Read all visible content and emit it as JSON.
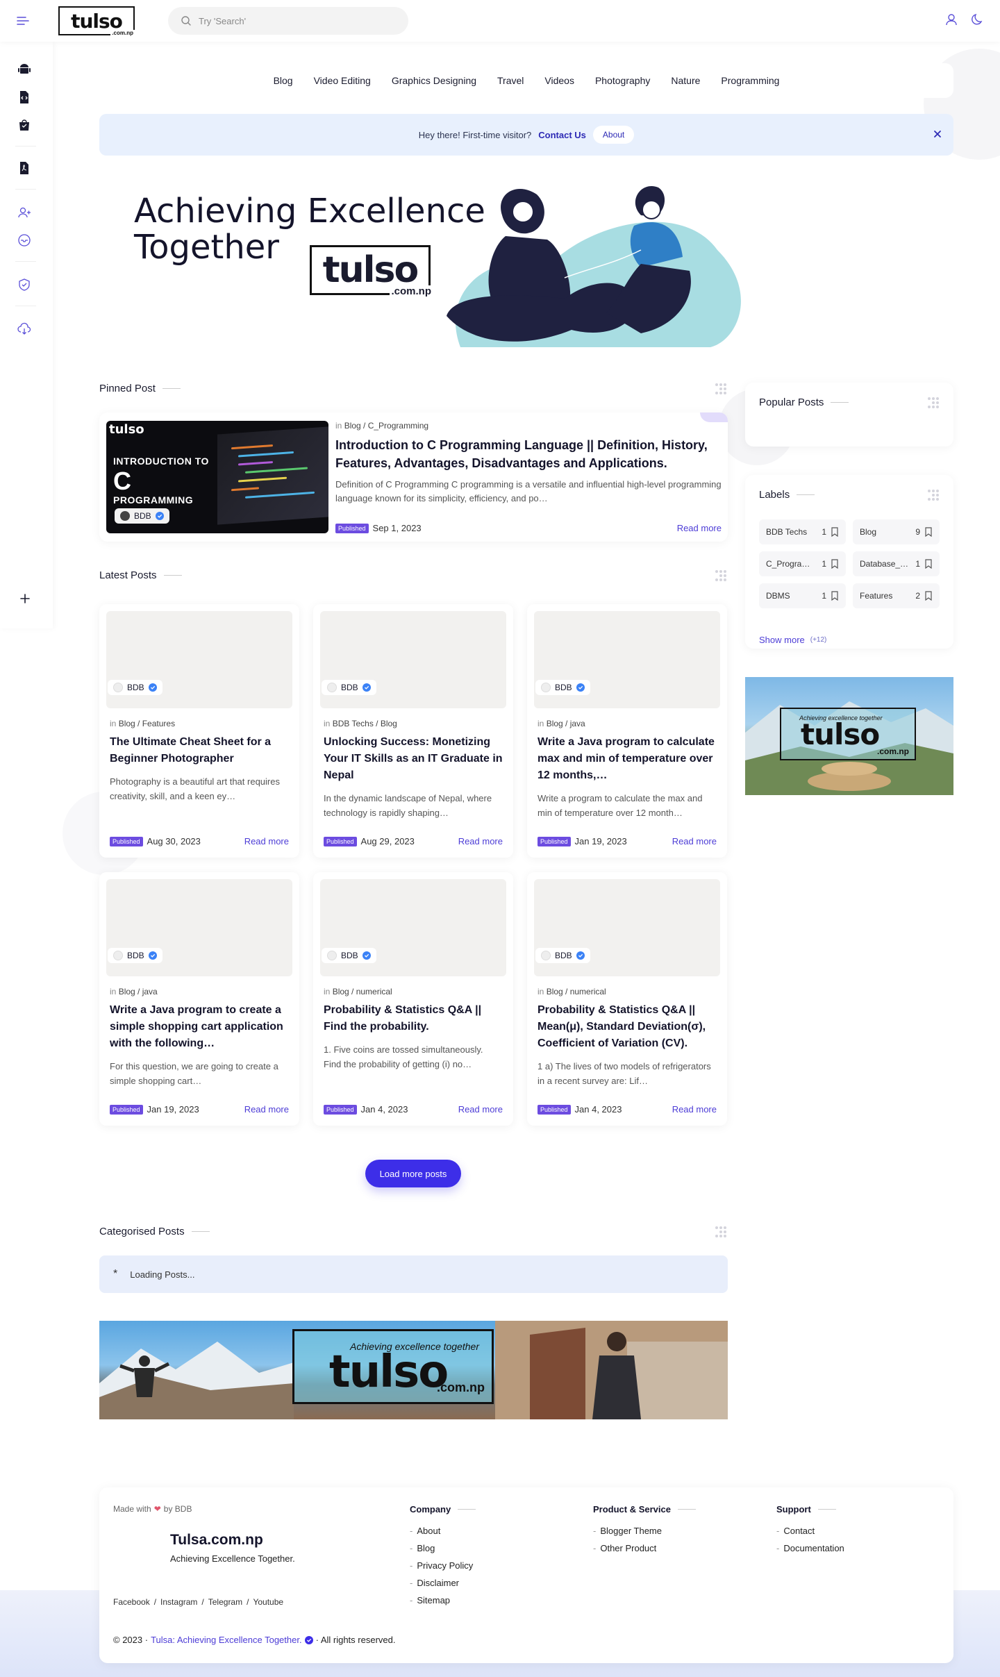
{
  "header": {
    "logo_text": "tulso",
    "logo_sub": ".com.np",
    "search_placeholder": "Try 'Search'"
  },
  "nav": [
    "Blog",
    "Video Editing",
    "Graphics Designing",
    "Travel",
    "Videos",
    "Photography",
    "Nature",
    "Programming"
  ],
  "notice": {
    "text": "Hey there! First-time visitor?",
    "link": "Contact Us",
    "button": "About"
  },
  "hero": {
    "line1": "Achieving Excellence",
    "line2": "Together",
    "logo_text": "tulso",
    "logo_sub": ".com.np"
  },
  "pinned": {
    "section_title": "Pinned Post",
    "thumb": {
      "logo": "tulso",
      "t1": "INTRODUCTION TO",
      "t2": "C",
      "t3": "PROGRAMMING",
      "author": "BDB"
    },
    "crumb_prefix": "in",
    "crumb": "Blog / C_Programming",
    "title": "Introduction to C Programming Language || Definition, History, Features, Advantages, Disadvantages and Applications.",
    "excerpt": "Definition of C Programming C programming is a versatile and influential high-level programming language known for its simplicity, efficiency, and po…",
    "badge": "Published",
    "date": "Sep 1, 2023",
    "read_more": "Read more"
  },
  "latest": {
    "section_title": "Latest Posts",
    "posts": [
      {
        "author": "BDB",
        "crumb": "Blog / Features",
        "title": "The Ultimate Cheat Sheet for a Beginner Photographer",
        "excerpt": "Photography is a beautiful art that requires creativity, skill, and a keen ey…",
        "badge": "Published",
        "date": "Aug 30, 2023",
        "read_more": "Read more"
      },
      {
        "author": "BDB",
        "crumb": "BDB Techs / Blog",
        "title": "Unlocking Success: Monetizing Your IT Skills as an IT Graduate in Nepal",
        "excerpt": "In the dynamic landscape of Nepal, where technology is rapidly shaping…",
        "badge": "Published",
        "date": "Aug 29, 2023",
        "read_more": "Read more"
      },
      {
        "author": "BDB",
        "crumb": "Blog / java",
        "title": "Write a Java program to calculate max and min of temperature over 12 months,…",
        "excerpt": "Write a program to calculate the max and min of temperature over 12 month…",
        "badge": "Published",
        "date": "Jan 19, 2023",
        "read_more": "Read more"
      },
      {
        "author": "BDB",
        "crumb": "Blog / java",
        "title": "Write a Java program to create a simple shopping cart application with the following…",
        "excerpt": "For this question, we are going to create a simple shopping cart…",
        "badge": "Published",
        "date": "Jan 19, 2023",
        "read_more": "Read more"
      },
      {
        "author": "BDB",
        "crumb": "Blog / numerical",
        "title": "Probability & Statistics Q&A || Find the probability.",
        "excerpt": "1. Five coins are tossed simultaneously. Find the probability of getting (i) no…",
        "badge": "Published",
        "date": "Jan 4, 2023",
        "read_more": "Read more"
      },
      {
        "author": "BDB",
        "crumb": "Blog / numerical",
        "title": "Probability & Statistics Q&A || Mean(μ), Standard Deviation(σ), Coefficient of Variation (CV).",
        "excerpt": "1 a) The lives of two models of refrigerators in a recent survey are: Lif…",
        "badge": "Published",
        "date": "Jan 4, 2023",
        "read_more": "Read more"
      }
    ],
    "load_more": "Load more posts"
  },
  "categorised": {
    "section_title": "Categorised Posts",
    "loading_icon": "*",
    "loading": "Loading Posts..."
  },
  "banner": {
    "tag": "Achieving excellence together",
    "logo": "tulso",
    "sub": ".com.np"
  },
  "sidebar": {
    "popular_title": "Popular Posts",
    "labels_title": "Labels",
    "labels": [
      {
        "name": "BDB Techs",
        "count": "1"
      },
      {
        "name": "Blog",
        "count": "9"
      },
      {
        "name": "C_Progra…",
        "count": "1"
      },
      {
        "name": "Database_…",
        "count": "1"
      },
      {
        "name": "DBMS",
        "count": "1"
      },
      {
        "name": "Features",
        "count": "2"
      }
    ],
    "show_more": "Show more",
    "show_more_count": "(+12)",
    "banner_tag": "Achieving excellence together",
    "banner_logo": "tulso",
    "banner_sub": ".com.np"
  },
  "footer": {
    "made_with": "Made with",
    "by": "by BDB",
    "site_name": "Tulsa.com.np",
    "tagline": "Achieving Excellence Together.",
    "social": [
      "Facebook",
      "/",
      "Instagram",
      "/",
      "Telegram",
      "/",
      "Youtube"
    ],
    "columns": [
      {
        "title": "Company",
        "links": [
          "About",
          "Blog",
          "Privacy Policy",
          "Disclaimer",
          "Sitemap"
        ]
      },
      {
        "title": "Product & Service",
        "links": [
          "Blogger Theme",
          "Other Product"
        ]
      },
      {
        "title": "Support",
        "links": [
          "Contact",
          "Documentation"
        ]
      }
    ],
    "copyright": "© 2023 ·",
    "brand": "Tulsa: Achieving Excellence Together.",
    "rights": "· All rights reserved."
  },
  "colors": {
    "accent": "#3d2ee8",
    "badge": "#6c4ce0",
    "notice_bg": "#e8f0fd",
    "hero_blob": "#a8dde2",
    "hero_figure": "#1f2140",
    "hero_shirt": "#2f7fc6"
  }
}
